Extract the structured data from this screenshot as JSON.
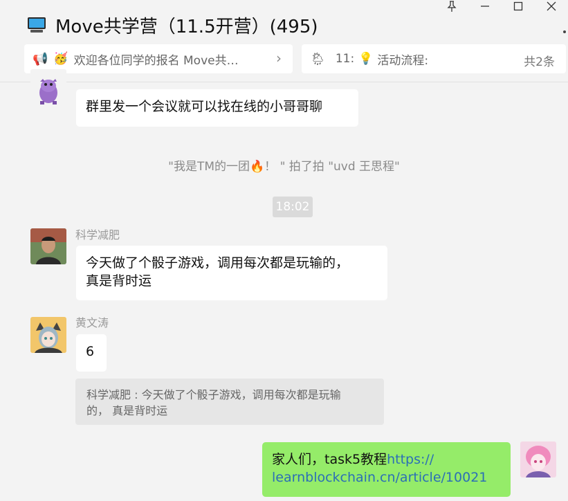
{
  "header": {
    "title": "Move共学营（11.5开营）(495)",
    "window_controls": {
      "pin_icon": "pin-icon",
      "minimize_icon": "minimize-icon",
      "maximize_icon": "maximize-icon",
      "close_icon": "close-icon"
    }
  },
  "notices": {
    "left": {
      "emoji_1": "📢",
      "emoji_2": "🥳",
      "text": "欢迎各位同学的报名  Move共…",
      "chevron": "›"
    },
    "right": {
      "emoji_1": "🌦",
      "prefix": "11:",
      "emoji_2": "💡",
      "text": "活动流程:",
      "count": "共2条"
    }
  },
  "messages": {
    "m1": {
      "text": "群里发一个会议就可以找在线的小哥哥聊"
    },
    "system_pat": "\"我是TM的一团🔥！ \" 拍了拍 \"uvd 王思程\"",
    "timestamp": "18:02",
    "m2": {
      "sender": "科学减肥",
      "line1": "今天做了个骰子游戏，调用每次都是玩输的，",
      "line2": "真是背时运"
    },
    "m3": {
      "sender": "黄文涛",
      "text": "6",
      "quote_line1": "科学减肥 : 今天做了个骰子游戏，调用每次都是玩输",
      "quote_line2": "的， 真是背时运"
    },
    "m4": {
      "line1_text": "家人们，task5教程",
      "line1_link": "https://",
      "line2_link": "learnblockchain.cn/article/10021"
    }
  },
  "colors": {
    "self_bubble": "#95ec69",
    "link": "#2b6fb6"
  }
}
